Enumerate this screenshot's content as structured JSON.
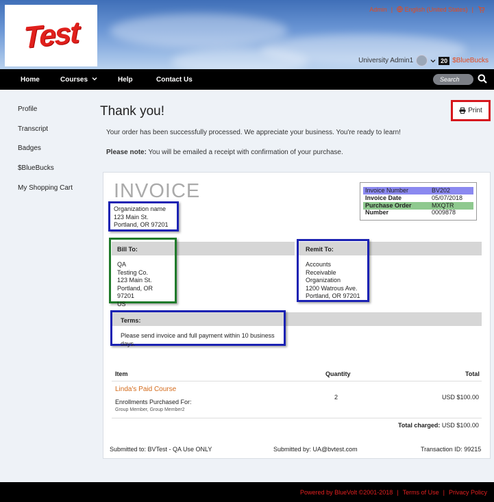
{
  "header": {
    "logo_text": "Test",
    "admin_link": "Admin",
    "language": "English (United States)",
    "user_name": "University Admin1",
    "bluebucks_count": "20",
    "bluebucks_label": "$BlueBucks"
  },
  "nav": {
    "items": [
      "Home",
      "Courses",
      "Help",
      "Contact Us"
    ],
    "search_placeholder": "Search"
  },
  "sidebar": {
    "items": [
      "Profile",
      "Transcript",
      "Badges",
      "$BlueBucks",
      "My Shopping Cart"
    ]
  },
  "main": {
    "title": "Thank you!",
    "print_label": "Print",
    "message": "Your order has been successfully processed. We appreciate your business. You're ready to learn!",
    "note_bold": "Please note:",
    "note_text": " You will be emailed a receipt with confirmation of your purchase."
  },
  "invoice": {
    "title": "INVOICE",
    "org_lines": [
      "Organization name",
      "123 Main St.",
      "Portland, OR 97201"
    ],
    "meta": [
      {
        "label": "Invoice Number",
        "value": "BV202"
      },
      {
        "label": "Invoice Date",
        "value": "05/07/2018"
      },
      {
        "label": "Purchase Order Number",
        "value": "MXQTR 0009878"
      }
    ],
    "bill_to_label": "Bill To:",
    "bill_to_lines": [
      "QA",
      "Testing Co.",
      "123 Main St.",
      "Portland, OR 97201",
      "US"
    ],
    "remit_to_label": "Remit To:",
    "remit_to_lines": [
      "Accounts Receivable",
      "Organization",
      "1200 Watrous Ave.",
      "Portland, OR 97201"
    ],
    "terms_label": "Terms:",
    "terms_text": "Please send invoice and full payment within 10 business days.",
    "table": {
      "headers": [
        "Item",
        "Quantity",
        "Total"
      ],
      "course_name": "Linda's Paid Course",
      "enrollments_label": "Enrollments Purchased For:",
      "members": "Group Member, Group Member2",
      "quantity": "2",
      "total": "USD $100.00"
    },
    "total_charged_label": "Total charged:",
    "total_charged_value": " USD $100.00",
    "submitted_to": "Submitted to: BVTest - QA Use ONLY",
    "submitted_by": "Submitted by: UA@bvtest.com",
    "transaction_id": "Transaction ID: 99215"
  },
  "footer": {
    "powered": "Powered by BlueVolt ©2001-2018",
    "terms": "Terms of Use",
    "privacy": "Privacy Policy"
  },
  "colors": {
    "accent_orange": "#e84a1a",
    "highlight_red": "#d6161c",
    "highlight_blue": "#1b22b3",
    "highlight_green": "#1f7a2a",
    "nav_bg": "#000000"
  }
}
